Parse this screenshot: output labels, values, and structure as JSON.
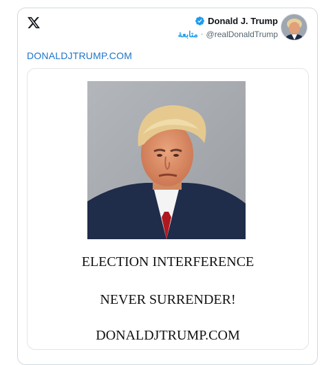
{
  "author": {
    "display_name": "Donald J. Trump",
    "handle": "@realDonaldTrump",
    "follow_label": "متابعة",
    "separator": "·"
  },
  "link_text": "DONALDJTRUMP.COM",
  "poster": {
    "line1": "ELECTION INTERFERENCE",
    "line2": "NEVER SURRENDER!",
    "line3": "DONALDJTRUMP.COM"
  },
  "icons": {
    "logo": "x-logo-icon",
    "verified": "verified-badge-icon"
  },
  "colors": {
    "accent": "#1d9bf0",
    "link": "#1d73c9",
    "border": "#cfd9de",
    "text": "#0f1419",
    "muted": "#536471"
  }
}
